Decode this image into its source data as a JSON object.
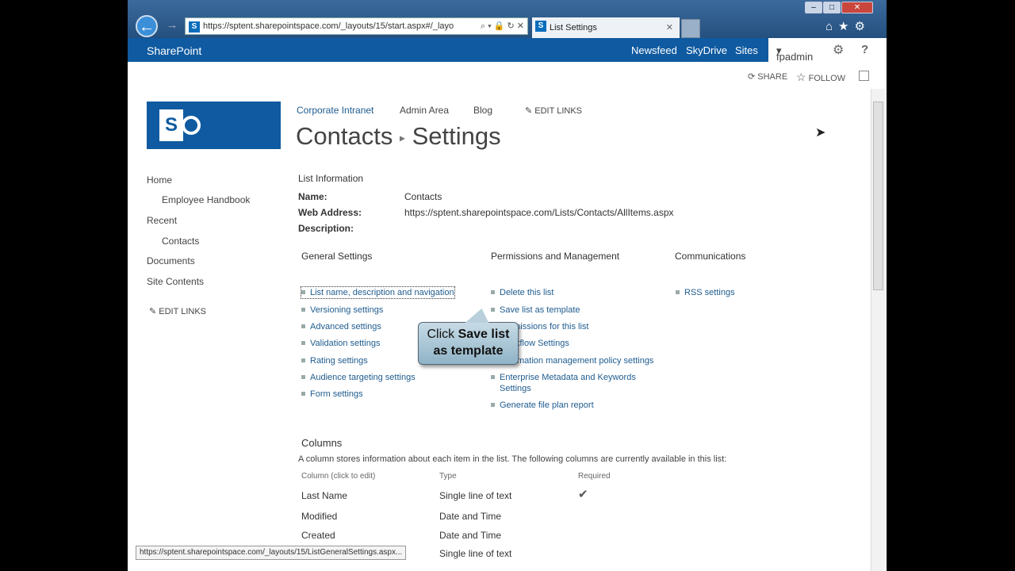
{
  "browser": {
    "url": "https://sptent.sharepointspace.com/_layouts/15/start.aspx#/_layo",
    "tab_title": "List Settings",
    "status_url": "https://sptent.sharepointspace.com/_layouts/15/ListGeneralSettings.aspx..."
  },
  "suite": {
    "brand": "SharePoint",
    "links": [
      "Newsfeed",
      "SkyDrive",
      "Sites"
    ],
    "user": "fpadmin",
    "share": "SHARE",
    "follow": "FOLLOW"
  },
  "topnav": {
    "items": [
      "Corporate Intranet",
      "Admin Area",
      "Blog"
    ],
    "edit_links": "EDIT LINKS"
  },
  "title": {
    "list": "Contacts",
    "page": "Settings"
  },
  "quicklaunch": {
    "items": [
      "Home",
      "Employee Handbook",
      "Recent",
      "Contacts",
      "Documents",
      "Site Contents"
    ],
    "edit_links": "EDIT LINKS"
  },
  "list_info": {
    "heading": "List Information",
    "name_label": "Name:",
    "name": "Contacts",
    "web_label": "Web Address:",
    "web": "https://sptent.sharepointspace.com/Lists/Contacts/AllItems.aspx",
    "desc_label": "Description:"
  },
  "general": {
    "heading": "General Settings",
    "links": [
      "List name, description and navigation",
      "Versioning settings",
      "Advanced settings",
      "Validation settings",
      "Rating settings",
      "Audience targeting settings",
      "Form settings"
    ]
  },
  "permissions": {
    "heading": "Permissions and Management",
    "links": [
      "Delete this list",
      "Save list as template",
      "Permissions for this list",
      "Workflow Settings",
      "Information management policy settings",
      "Enterprise Metadata and Keywords Settings",
      "Generate file plan report"
    ]
  },
  "communications": {
    "heading": "Communications",
    "links": [
      "RSS settings"
    ]
  },
  "columns": {
    "heading": "Columns",
    "desc": "A column stores information about each item in the list. The following columns are currently available in this list:",
    "headers": [
      "Column (click to edit)",
      "Type",
      "Required"
    ],
    "rows": [
      {
        "name": "Last Name",
        "type": "Single line of text",
        "required": "✔"
      },
      {
        "name": "Modified",
        "type": "Date and Time",
        "required": ""
      },
      {
        "name": "Created",
        "type": "Date and Time",
        "required": ""
      },
      {
        "name": "",
        "type": "Single line of text",
        "required": ""
      }
    ]
  },
  "callout": {
    "pre": "Click ",
    "bold1": "Save list",
    "bold2": "as template"
  }
}
